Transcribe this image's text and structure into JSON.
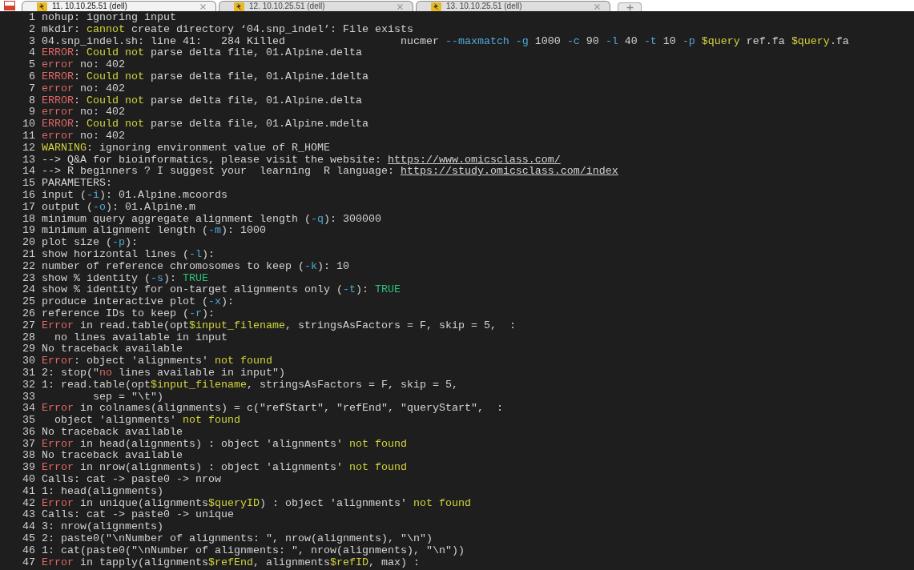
{
  "tabs": [
    {
      "label": "11. 10.10.25.51 (dell)",
      "selected": true
    },
    {
      "label": "12. 10.10.25.51 (dell)",
      "selected": false
    },
    {
      "label": "13. 10.10.25.51 (dell)",
      "selected": false
    }
  ],
  "terminal": {
    "lines": [
      {
        "number": "1",
        "segments": [
          {
            "kind": "plain",
            "text": "nohup: ignoring input"
          }
        ]
      },
      {
        "number": "2",
        "segments": [
          {
            "kind": "plain",
            "text": "mkdir: "
          },
          {
            "kind": "warning",
            "text": "cannot"
          },
          {
            "kind": "plain",
            "text": " create directory ‘04.snp_indel’: File exists"
          }
        ]
      },
      {
        "number": "3",
        "segments": [
          {
            "kind": "plain",
            "text": "04.snp_indel.sh: line 41:   284 Killed                  nucmer "
          },
          {
            "kind": "option",
            "text": "--maxmatch -g"
          },
          {
            "kind": "plain",
            "text": " 1000 "
          },
          {
            "kind": "option",
            "text": "-c"
          },
          {
            "kind": "plain",
            "text": " 90 "
          },
          {
            "kind": "option",
            "text": "-l"
          },
          {
            "kind": "plain",
            "text": " 40 "
          },
          {
            "kind": "option",
            "text": "-t"
          },
          {
            "kind": "plain",
            "text": " 10 "
          },
          {
            "kind": "option",
            "text": "-p"
          },
          {
            "kind": "variable",
            "text": " $query"
          },
          {
            "kind": "plain",
            "text": " ref.fa "
          },
          {
            "kind": "variable",
            "text": "$query"
          },
          {
            "kind": "plain",
            "text": ".fa"
          }
        ]
      },
      {
        "number": "4",
        "segments": [
          {
            "kind": "error",
            "text": "ERROR"
          },
          {
            "kind": "plain",
            "text": ": "
          },
          {
            "kind": "warning",
            "text": "Could not"
          },
          {
            "kind": "plain",
            "text": " parse delta file, 01.Alpine.delta"
          }
        ]
      },
      {
        "number": "5",
        "segments": [
          {
            "kind": "error",
            "text": "error"
          },
          {
            "kind": "plain",
            "text": " no: 402"
          }
        ]
      },
      {
        "number": "6",
        "segments": [
          {
            "kind": "error",
            "text": "ERROR"
          },
          {
            "kind": "plain",
            "text": ": "
          },
          {
            "kind": "warning",
            "text": "Could not"
          },
          {
            "kind": "plain",
            "text": " parse delta file, 01.Alpine.1delta"
          }
        ]
      },
      {
        "number": "7",
        "segments": [
          {
            "kind": "error",
            "text": "error"
          },
          {
            "kind": "plain",
            "text": " no: 402"
          }
        ]
      },
      {
        "number": "8",
        "segments": [
          {
            "kind": "error",
            "text": "ERROR"
          },
          {
            "kind": "plain",
            "text": ": "
          },
          {
            "kind": "warning",
            "text": "Could not"
          },
          {
            "kind": "plain",
            "text": " parse delta file, 01.Alpine.delta"
          }
        ]
      },
      {
        "number": "9",
        "segments": [
          {
            "kind": "error",
            "text": "error"
          },
          {
            "kind": "plain",
            "text": " no: 402"
          }
        ]
      },
      {
        "number": "10",
        "segments": [
          {
            "kind": "error",
            "text": "ERROR"
          },
          {
            "kind": "plain",
            "text": ": "
          },
          {
            "kind": "warning",
            "text": "Could not"
          },
          {
            "kind": "plain",
            "text": " parse delta file, 01.Alpine.mdelta"
          }
        ]
      },
      {
        "number": "11",
        "segments": [
          {
            "kind": "error",
            "text": "error"
          },
          {
            "kind": "plain",
            "text": " no: 402"
          }
        ]
      },
      {
        "number": "12",
        "segments": [
          {
            "kind": "warning",
            "text": "WARNING"
          },
          {
            "kind": "plain",
            "text": ": ignoring environment value of R_HOME"
          }
        ]
      },
      {
        "number": "13",
        "segments": [
          {
            "kind": "plain",
            "text": "--> Q&A for bioinformatics, please visit the website: "
          },
          {
            "kind": "link",
            "text": "https://www.omicsclass.com/"
          }
        ]
      },
      {
        "number": "14",
        "segments": [
          {
            "kind": "plain",
            "text": "--> R beginners ? I suggest your  learning  R language: "
          },
          {
            "kind": "link",
            "text": "https://study.omicsclass.com/index"
          }
        ]
      },
      {
        "number": "15",
        "segments": [
          {
            "kind": "plain",
            "text": "PARAMETERS:"
          }
        ]
      },
      {
        "number": "16",
        "segments": [
          {
            "kind": "plain",
            "text": "input ("
          },
          {
            "kind": "option",
            "text": "-i"
          },
          {
            "kind": "plain",
            "text": "): 01.Alpine.mcoords"
          }
        ]
      },
      {
        "number": "17",
        "segments": [
          {
            "kind": "plain",
            "text": "output ("
          },
          {
            "kind": "option",
            "text": "-o"
          },
          {
            "kind": "plain",
            "text": "): 01.Alpine.m"
          }
        ]
      },
      {
        "number": "18",
        "segments": [
          {
            "kind": "plain",
            "text": "minimum query aggregate alignment length ("
          },
          {
            "kind": "option",
            "text": "-q"
          },
          {
            "kind": "plain",
            "text": "): 300000"
          }
        ]
      },
      {
        "number": "19",
        "segments": [
          {
            "kind": "plain",
            "text": "minimum alignment length ("
          },
          {
            "kind": "option",
            "text": "-m"
          },
          {
            "kind": "plain",
            "text": "): 1000"
          }
        ]
      },
      {
        "number": "20",
        "segments": [
          {
            "kind": "plain",
            "text": "plot size ("
          },
          {
            "kind": "option",
            "text": "-p"
          },
          {
            "kind": "plain",
            "text": "):"
          }
        ]
      },
      {
        "number": "21",
        "segments": [
          {
            "kind": "plain",
            "text": "show horizontal lines ("
          },
          {
            "kind": "option",
            "text": "-l"
          },
          {
            "kind": "plain",
            "text": "):"
          }
        ]
      },
      {
        "number": "22",
        "segments": [
          {
            "kind": "plain",
            "text": "number of reference chromosomes to keep ("
          },
          {
            "kind": "option",
            "text": "-k"
          },
          {
            "kind": "plain",
            "text": "): 10"
          }
        ]
      },
      {
        "number": "23",
        "segments": [
          {
            "kind": "plain",
            "text": "show % identity ("
          },
          {
            "kind": "option",
            "text": "-s"
          },
          {
            "kind": "plain",
            "text": "): "
          },
          {
            "kind": "boolean",
            "text": "TRUE"
          }
        ]
      },
      {
        "number": "24",
        "segments": [
          {
            "kind": "plain",
            "text": "show % identity for on-target alignments only ("
          },
          {
            "kind": "option",
            "text": "-t"
          },
          {
            "kind": "plain",
            "text": "): "
          },
          {
            "kind": "boolean",
            "text": "TRUE"
          }
        ]
      },
      {
        "number": "25",
        "segments": [
          {
            "kind": "plain",
            "text": "produce interactive plot ("
          },
          {
            "kind": "option",
            "text": "-x"
          },
          {
            "kind": "plain",
            "text": "):"
          }
        ]
      },
      {
        "number": "26",
        "segments": [
          {
            "kind": "plain",
            "text": "reference IDs to keep ("
          },
          {
            "kind": "option",
            "text": "-r"
          },
          {
            "kind": "plain",
            "text": "):"
          }
        ]
      },
      {
        "number": "27",
        "segments": [
          {
            "kind": "error",
            "text": "Error"
          },
          {
            "kind": "plain",
            "text": " in read.table(opt"
          },
          {
            "kind": "variable",
            "text": "$input_filename"
          },
          {
            "kind": "plain",
            "text": ", stringsAsFactors = F, skip = 5,  :"
          }
        ]
      },
      {
        "number": "28",
        "segments": [
          {
            "kind": "plain",
            "text": "  no lines available in input"
          }
        ]
      },
      {
        "number": "29",
        "segments": [
          {
            "kind": "plain",
            "text": "No traceback available"
          }
        ]
      },
      {
        "number": "30",
        "segments": [
          {
            "kind": "error",
            "text": "Error"
          },
          {
            "kind": "plain",
            "text": ": object 'alignments' "
          },
          {
            "kind": "warning",
            "text": "not found"
          }
        ]
      },
      {
        "number": "31",
        "segments": [
          {
            "kind": "plain",
            "text": "2: stop(\""
          },
          {
            "kind": "error",
            "text": "no"
          },
          {
            "kind": "plain",
            "text": " lines available in input\")"
          }
        ]
      },
      {
        "number": "32",
        "segments": [
          {
            "kind": "plain",
            "text": "1: read.table(opt"
          },
          {
            "kind": "variable",
            "text": "$input_filename"
          },
          {
            "kind": "plain",
            "text": ", stringsAsFactors = F, skip = 5,"
          }
        ]
      },
      {
        "number": "33",
        "segments": [
          {
            "kind": "plain",
            "text": "        sep = \"\\t\")"
          }
        ]
      },
      {
        "number": "34",
        "segments": [
          {
            "kind": "error",
            "text": "Error"
          },
          {
            "kind": "plain",
            "text": " in colnames(alignments) = c(\"refStart\", \"refEnd\", \"queryStart\",  :"
          }
        ]
      },
      {
        "number": "35",
        "segments": [
          {
            "kind": "plain",
            "text": "  object 'alignments' "
          },
          {
            "kind": "warning",
            "text": "not found"
          }
        ]
      },
      {
        "number": "36",
        "segments": [
          {
            "kind": "plain",
            "text": "No traceback available"
          }
        ]
      },
      {
        "number": "37",
        "segments": [
          {
            "kind": "error",
            "text": "Error"
          },
          {
            "kind": "plain",
            "text": " in head(alignments) : object 'alignments' "
          },
          {
            "kind": "warning",
            "text": "not found"
          }
        ]
      },
      {
        "number": "38",
        "segments": [
          {
            "kind": "plain",
            "text": "No traceback available"
          }
        ]
      },
      {
        "number": "39",
        "segments": [
          {
            "kind": "error",
            "text": "Error"
          },
          {
            "kind": "plain",
            "text": " in nrow(alignments) : object 'alignments' "
          },
          {
            "kind": "warning",
            "text": "not found"
          }
        ]
      },
      {
        "number": "40",
        "segments": [
          {
            "kind": "plain",
            "text": "Calls: cat -> paste0 -> nrow"
          }
        ]
      },
      {
        "number": "41",
        "segments": [
          {
            "kind": "plain",
            "text": "1: head(alignments)"
          }
        ]
      },
      {
        "number": "42",
        "segments": [
          {
            "kind": "error",
            "text": "Error"
          },
          {
            "kind": "plain",
            "text": " in unique(alignments"
          },
          {
            "kind": "variable",
            "text": "$queryID"
          },
          {
            "kind": "plain",
            "text": ") : object 'alignments' "
          },
          {
            "kind": "warning",
            "text": "not found"
          }
        ]
      },
      {
        "number": "43",
        "segments": [
          {
            "kind": "plain",
            "text": "Calls: cat -> paste0 -> unique"
          }
        ]
      },
      {
        "number": "44",
        "segments": [
          {
            "kind": "plain",
            "text": "3: nrow(alignments)"
          }
        ]
      },
      {
        "number": "45",
        "segments": [
          {
            "kind": "plain",
            "text": "2: paste0(\"\\nNumber of alignments: \", nrow(alignments), \"\\n\")"
          }
        ]
      },
      {
        "number": "46",
        "segments": [
          {
            "kind": "plain",
            "text": "1: cat(paste0(\"\\nNumber of alignments: \", nrow(alignments), \"\\n\"))"
          }
        ]
      },
      {
        "number": "47",
        "segments": [
          {
            "kind": "error",
            "text": "Error"
          },
          {
            "kind": "plain",
            "text": " in tapply(alignments"
          },
          {
            "kind": "variable",
            "text": "$refEnd"
          },
          {
            "kind": "plain",
            "text": ", alignments"
          },
          {
            "kind": "variable",
            "text": "$refID"
          },
          {
            "kind": "plain",
            "text": ", max) :"
          }
        ]
      }
    ]
  }
}
